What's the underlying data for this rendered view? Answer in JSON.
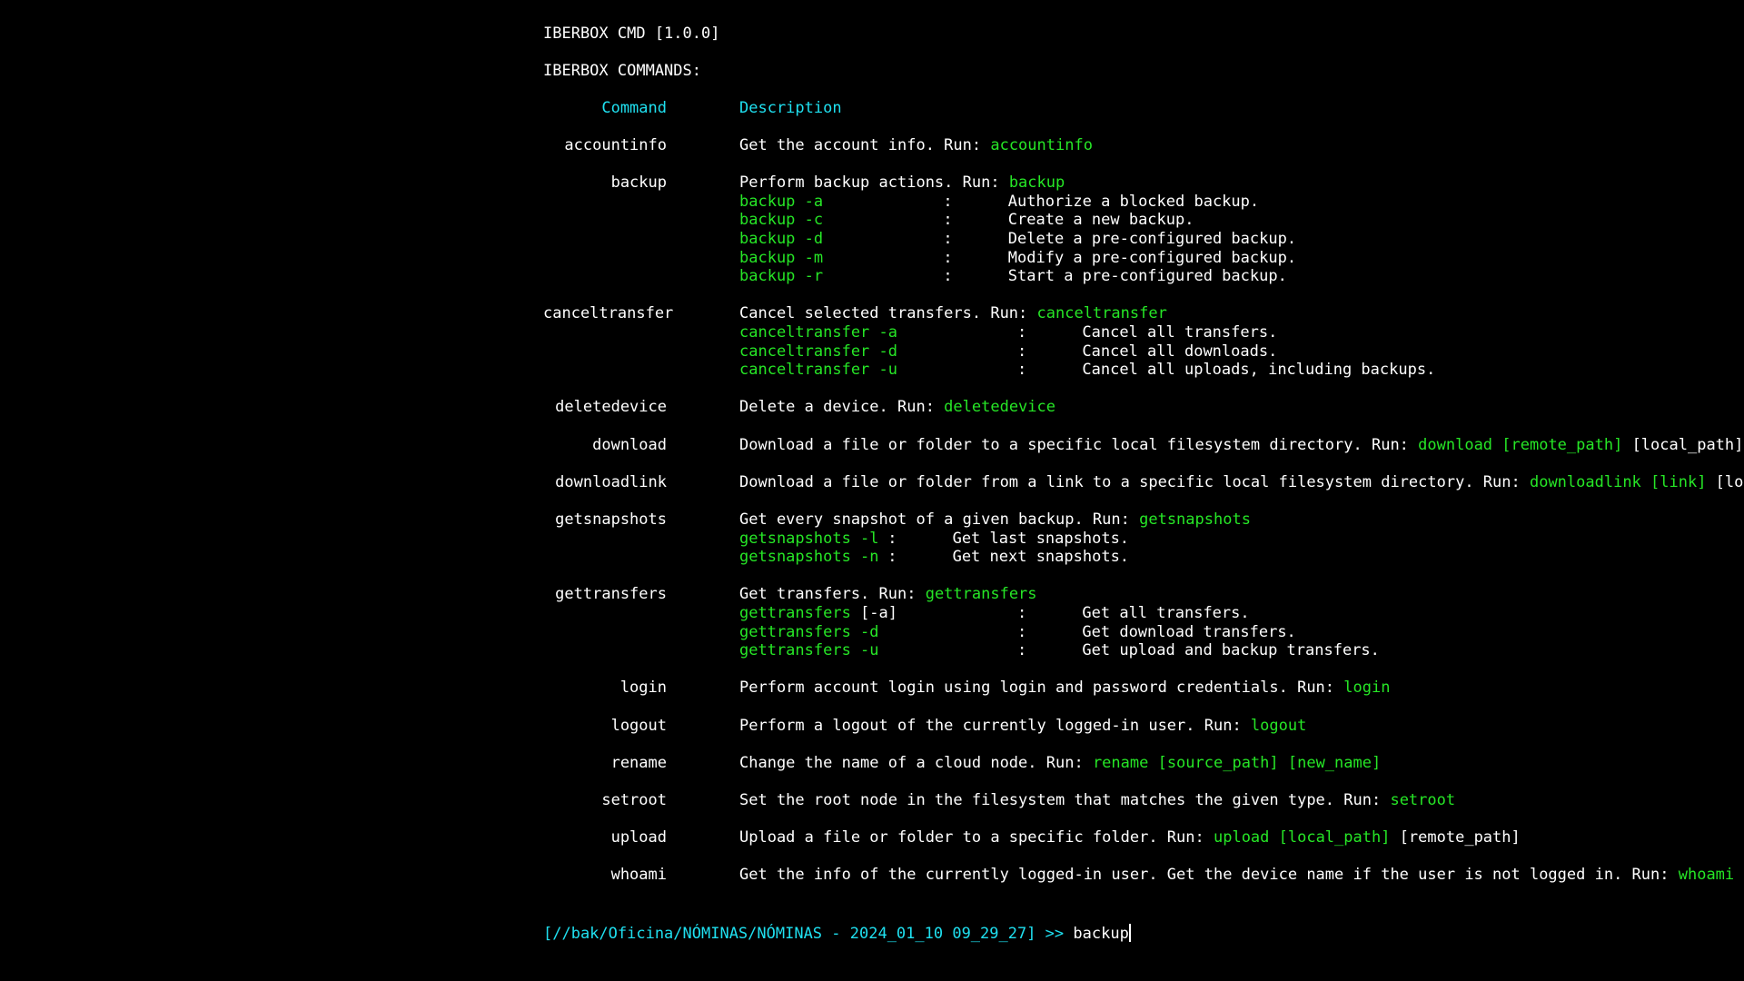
{
  "app_title": "IBERBOX CMD [1.0.0]",
  "commands_heading": "IBERBOX COMMANDS:",
  "columns": {
    "command": "Command",
    "description": "Description"
  },
  "commands": [
    {
      "name": "accountinfo",
      "desc": "Get the account info. Run: ",
      "run": "accountinfo",
      "run_extra": "",
      "options": []
    },
    {
      "name": "backup",
      "desc": "Perform backup actions. Run: ",
      "run": "backup",
      "run_extra": "",
      "options": [
        {
          "flag": "backup -a",
          "flag_extra": "",
          "desc": "Authorize a blocked backup."
        },
        {
          "flag": "backup -c",
          "flag_extra": "",
          "desc": "Create a new backup."
        },
        {
          "flag": "backup -d",
          "flag_extra": "",
          "desc": "Delete a pre-configured backup."
        },
        {
          "flag": "backup -m",
          "flag_extra": "",
          "desc": "Modify a pre-configured backup."
        },
        {
          "flag": "backup -r",
          "flag_extra": "",
          "desc": "Start a pre-configured backup."
        }
      ]
    },
    {
      "name": "canceltransfer",
      "desc": "Cancel selected transfers. Run: ",
      "run": "canceltransfer",
      "run_extra": "",
      "options": [
        {
          "flag": "canceltransfer -a",
          "flag_extra": "",
          "desc": "Cancel all transfers."
        },
        {
          "flag": "canceltransfer -d",
          "flag_extra": "",
          "desc": "Cancel all downloads."
        },
        {
          "flag": "canceltransfer -u",
          "flag_extra": "",
          "desc": "Cancel all uploads, including backups."
        }
      ]
    },
    {
      "name": "deletedevice",
      "desc": "Delete a device. Run: ",
      "run": "deletedevice",
      "run_extra": "",
      "options": []
    },
    {
      "name": "download",
      "desc": "Download a file or folder to a specific local filesystem directory. Run: ",
      "run": "download [remote_path]",
      "run_extra": " [local_path]",
      "options": []
    },
    {
      "name": "downloadlink",
      "desc": "Download a file or folder from a link to a specific local filesystem directory. Run: ",
      "run": "downloadlink [link]",
      "run_extra": " [local_path]",
      "options": []
    },
    {
      "name": "getsnapshots",
      "desc": "Get every snapshot of a given backup. Run: ",
      "run": "getsnapshots",
      "run_extra": "",
      "options": [
        {
          "flag": "getsnapshots -l",
          "flag_extra": "",
          "desc": "Get last snapshots."
        },
        {
          "flag": "getsnapshots -n",
          "flag_extra": "",
          "desc": "Get next snapshots."
        }
      ]
    },
    {
      "name": "gettransfers",
      "desc": "Get transfers. Run: ",
      "run": "gettransfers",
      "run_extra": "",
      "options": [
        {
          "flag": "gettransfers",
          "flag_extra": " [-a]",
          "desc": "Get all transfers."
        },
        {
          "flag": "gettransfers -d",
          "flag_extra": "",
          "desc": "Get download transfers."
        },
        {
          "flag": "gettransfers -u",
          "flag_extra": "",
          "desc": "Get upload and backup transfers."
        }
      ]
    },
    {
      "name": "login",
      "desc": "Perform account login using login and password credentials. Run: ",
      "run": "login",
      "run_extra": "",
      "options": []
    },
    {
      "name": "logout",
      "desc": "Perform a logout of the currently logged-in user. Run: ",
      "run": "logout",
      "run_extra": "",
      "options": []
    },
    {
      "name": "rename",
      "desc": "Change the name of a cloud node. Run: ",
      "run": "rename [source_path] [new_name]",
      "run_extra": "",
      "options": []
    },
    {
      "name": "setroot",
      "desc": "Set the root node in the filesystem that matches the given type. Run: ",
      "run": "setroot",
      "run_extra": "",
      "options": []
    },
    {
      "name": "upload",
      "desc": "Upload a file or folder to a specific folder. Run: ",
      "run": "upload [local_path]",
      "run_extra": " [remote_path]",
      "options": []
    },
    {
      "name": "whoami",
      "desc": "Get the info of the currently logged-in user. Get the device name if the user is not logged in. Run: ",
      "run": "whoami",
      "run_extra": "",
      "options": []
    }
  ],
  "option_separator": ":",
  "prompt": {
    "path": "[//bak/Oficina/NÓMINAS/NÓMINAS - 2024_01_10 09_29_27] >> ",
    "input": "backup"
  },
  "colors": {
    "background": "#000000",
    "text": "#ffffff",
    "cyan": "#1fe0f0",
    "green": "#26e626"
  }
}
